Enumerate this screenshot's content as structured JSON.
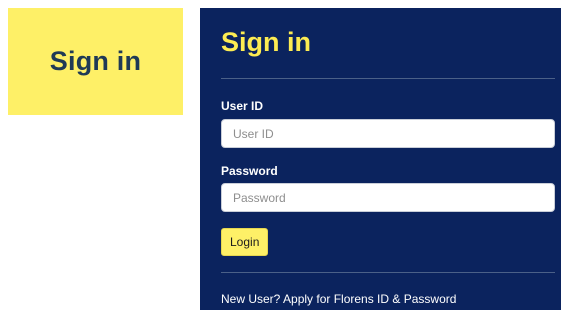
{
  "sign_in_tab": {
    "label": "Sign in"
  },
  "login_panel": {
    "title": "Sign in",
    "user_id": {
      "label": "User ID",
      "placeholder": "User ID",
      "value": ""
    },
    "password": {
      "label": "Password",
      "placeholder": "Password",
      "value": ""
    },
    "login_button_label": "Login",
    "new_user_link_text": "New User? Apply for Florens ID & Password"
  },
  "colors": {
    "tab_background": "#fef067",
    "tab_text": "#1f3a56",
    "panel_background": "#0b235e",
    "panel_title": "#fdec52",
    "button_background": "#fef067"
  }
}
